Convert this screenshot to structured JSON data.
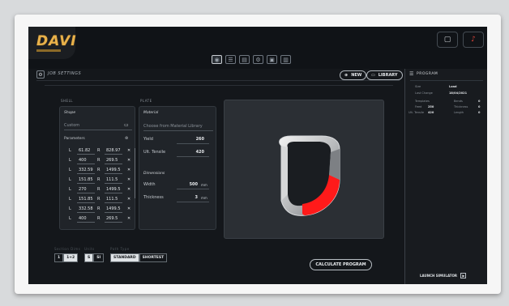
{
  "app": {
    "logo": "DAVI"
  },
  "toolbar": {
    "icons": [
      "view-icon",
      "list-icon",
      "document-icon",
      "settings-icon",
      "image-icon",
      "file-icon"
    ]
  },
  "job": {
    "title": "JOB SETTINGS"
  },
  "actions": {
    "new_label": "NEW",
    "library_label": "LIBRARY"
  },
  "shell": {
    "section_label": "SHELL",
    "shape_label": "Shape",
    "shape_value": "Custom",
    "parameters_label": "Parameters",
    "rows": [
      {
        "l": "L",
        "l_val": "61.82",
        "r": "R",
        "r_val": "828.97"
      },
      {
        "l": "L",
        "l_val": "400",
        "r": "R",
        "r_val": "269.5"
      },
      {
        "l": "L",
        "l_val": "332.59",
        "r": "R",
        "r_val": "1499.5"
      },
      {
        "l": "L",
        "l_val": "151.85",
        "r": "R",
        "r_val": "111.5"
      },
      {
        "l": "L",
        "l_val": "270",
        "r": "R",
        "r_val": "1499.5"
      },
      {
        "l": "L",
        "l_val": "151.85",
        "r": "R",
        "r_val": "111.5"
      },
      {
        "l": "L",
        "l_val": "332.58",
        "r": "R",
        "r_val": "1499.5"
      },
      {
        "l": "L",
        "l_val": "400",
        "r": "R",
        "r_val": "269.5"
      }
    ]
  },
  "plate": {
    "section_label": "PLATE",
    "material_label": "Material",
    "material_placeholder": "Choose from Material Library",
    "yield_label": "Yield",
    "yield_value": "260",
    "uts_label": "Ult. Tensile",
    "uts_value": "420",
    "dimensions_label": "Dimensions",
    "width_label": "Width",
    "width_value": "500",
    "width_unit": "mm",
    "thickness_label": "Thickness",
    "thickness_value": "3",
    "thickness_unit": "mm"
  },
  "bottom": {
    "group1_label": "Section Dims",
    "group1_options": [
      "1",
      "1+2"
    ],
    "group2_label": "Units",
    "group2_options": [
      "S",
      "SI"
    ],
    "group3_label": "Path Type",
    "group3_options": [
      "STANDARD",
      "SHORTEST"
    ],
    "calculate_label": "CALCULATE PROGRAM"
  },
  "program": {
    "title": "PROGRAM",
    "size_key": "Size",
    "size_value": "Load",
    "last_change_key": "Last Change",
    "last_change_value": "18/04/2021",
    "templates_key": "Templates",
    "bends_key": "Bends",
    "bends_value": "0",
    "feed_key": "Feed",
    "feed_value": "250",
    "thickness_key": "Thickness",
    "thickness_value": "0",
    "ult_tensile_key": "Ult. Tensile",
    "ult_tensile_value": "420",
    "length_key": "Length",
    "length_value": "0",
    "launch_label": "LAUNCH SIMULATOR"
  }
}
